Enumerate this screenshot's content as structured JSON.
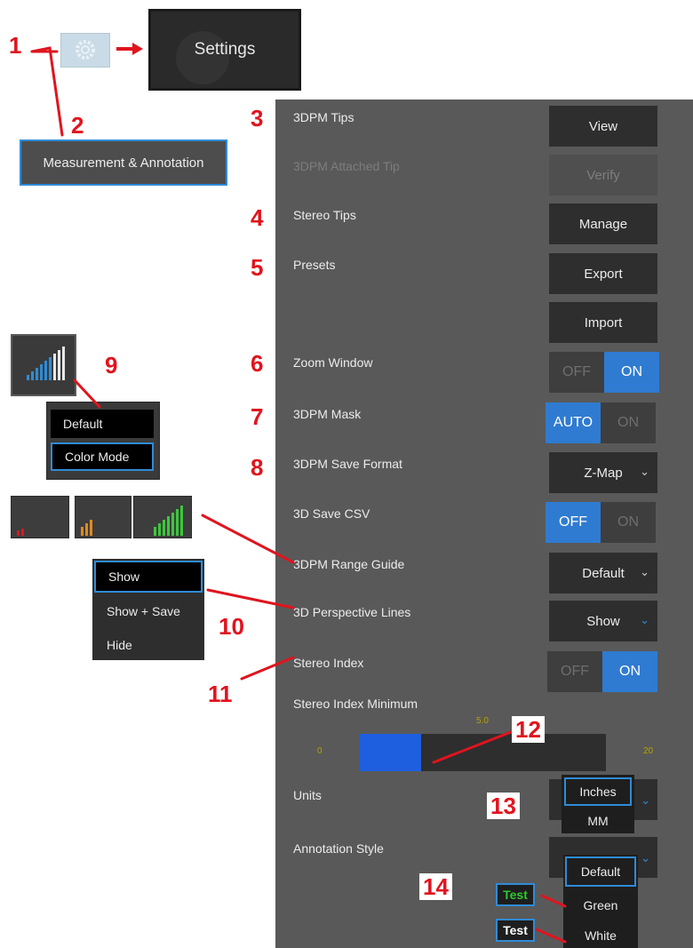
{
  "callouts": {
    "n1": "1",
    "n2": "2",
    "n3": "3",
    "n4": "4",
    "n5": "5",
    "n6": "6",
    "n7": "7",
    "n8": "8",
    "n9": "9",
    "n10": "10",
    "n11": "11",
    "n12": "12",
    "n13": "13",
    "n14": "14"
  },
  "top": {
    "settings_label": "Settings",
    "measurement_button": "Measurement & Annotation"
  },
  "rows": {
    "tips_label": "3DPM Tips",
    "tips_button": "View",
    "attached_label": "3DPM Attached Tip",
    "attached_button": "Verify",
    "stereo_tips_label": "Stereo Tips",
    "stereo_tips_button": "Manage",
    "presets_label": "Presets",
    "export_button": "Export",
    "import_button": "Import",
    "zoom_label": "Zoom Window",
    "zoom_off": "OFF",
    "zoom_on": "ON",
    "mask_label": "3DPM Mask",
    "mask_auto": "AUTO",
    "mask_on": "ON",
    "save_format_label": "3DPM Save Format",
    "save_format_value": "Z-Map",
    "csv_label": "3D Save CSV",
    "csv_off": "OFF",
    "csv_on": "ON",
    "range_label": "3DPM Range Guide",
    "range_value": "Default",
    "perspective_label": "3D Perspective Lines",
    "perspective_value": "Show",
    "stereo_index_label": "Stereo Index",
    "stereo_index_off": "OFF",
    "stereo_index_on": "ON",
    "stereo_min_label": "Stereo Index Minimum",
    "slider_min": "0",
    "slider_max": "20",
    "slider_value_label": "5.0",
    "slider_fraction": 0.25,
    "units_label": "Units",
    "annotation_label": "Annotation Style"
  },
  "menu9": {
    "default": "Default",
    "color_mode": "Color Mode"
  },
  "menu10": {
    "show": "Show",
    "show_save": "Show + Save",
    "hide": "Hide"
  },
  "units_dropdown": {
    "inches": "Inches",
    "mm": "MM"
  },
  "annotation_dropdown": {
    "default": "Default",
    "green": "Green",
    "white": "White"
  },
  "test_samples": {
    "green_label": "Test",
    "white_label": "Test"
  },
  "colors": {
    "panel_bg": "#595959",
    "button_bg": "#2e2e2e",
    "accent_blue": "#2f7bd1",
    "slider_fill": "#1e5fe0",
    "callout_red": "#e0141e"
  }
}
